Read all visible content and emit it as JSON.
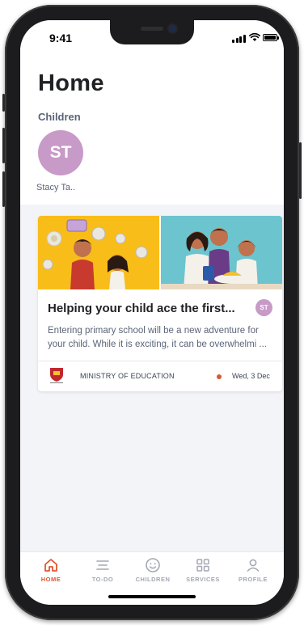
{
  "status_bar": {
    "time": "9:41"
  },
  "header": {
    "title": "Home"
  },
  "children_section": {
    "label": "Children",
    "children": [
      {
        "initials": "ST",
        "name": "Stacy Ta.."
      }
    ]
  },
  "feed": [
    {
      "title": "Helping your child ace the first...",
      "badge": "ST",
      "description": "Entering primary school will be a new adventure for your child. While it is exciting, it can be overwhelmi ...",
      "publisher": "MINISTRY OF EDUCATION",
      "date": "Wed, 3 Dec"
    }
  ],
  "tabbar": {
    "tabs": [
      {
        "label": "HOME",
        "icon": "home-icon",
        "active": true
      },
      {
        "label": "TO-DO",
        "icon": "list-icon",
        "active": false
      },
      {
        "label": "CHILDREN",
        "icon": "smiley-icon",
        "active": false
      },
      {
        "label": "SERVICES",
        "icon": "grid-icon",
        "active": false
      },
      {
        "label": "PROFILE",
        "icon": "user-icon",
        "active": false
      }
    ]
  },
  "colors": {
    "accent": "#e2552f",
    "avatar": "#c89ac7",
    "background": "#f3f4f7",
    "illustration_left_bg": "#f9bd19",
    "illustration_right_bg": "#6cc4ce"
  }
}
